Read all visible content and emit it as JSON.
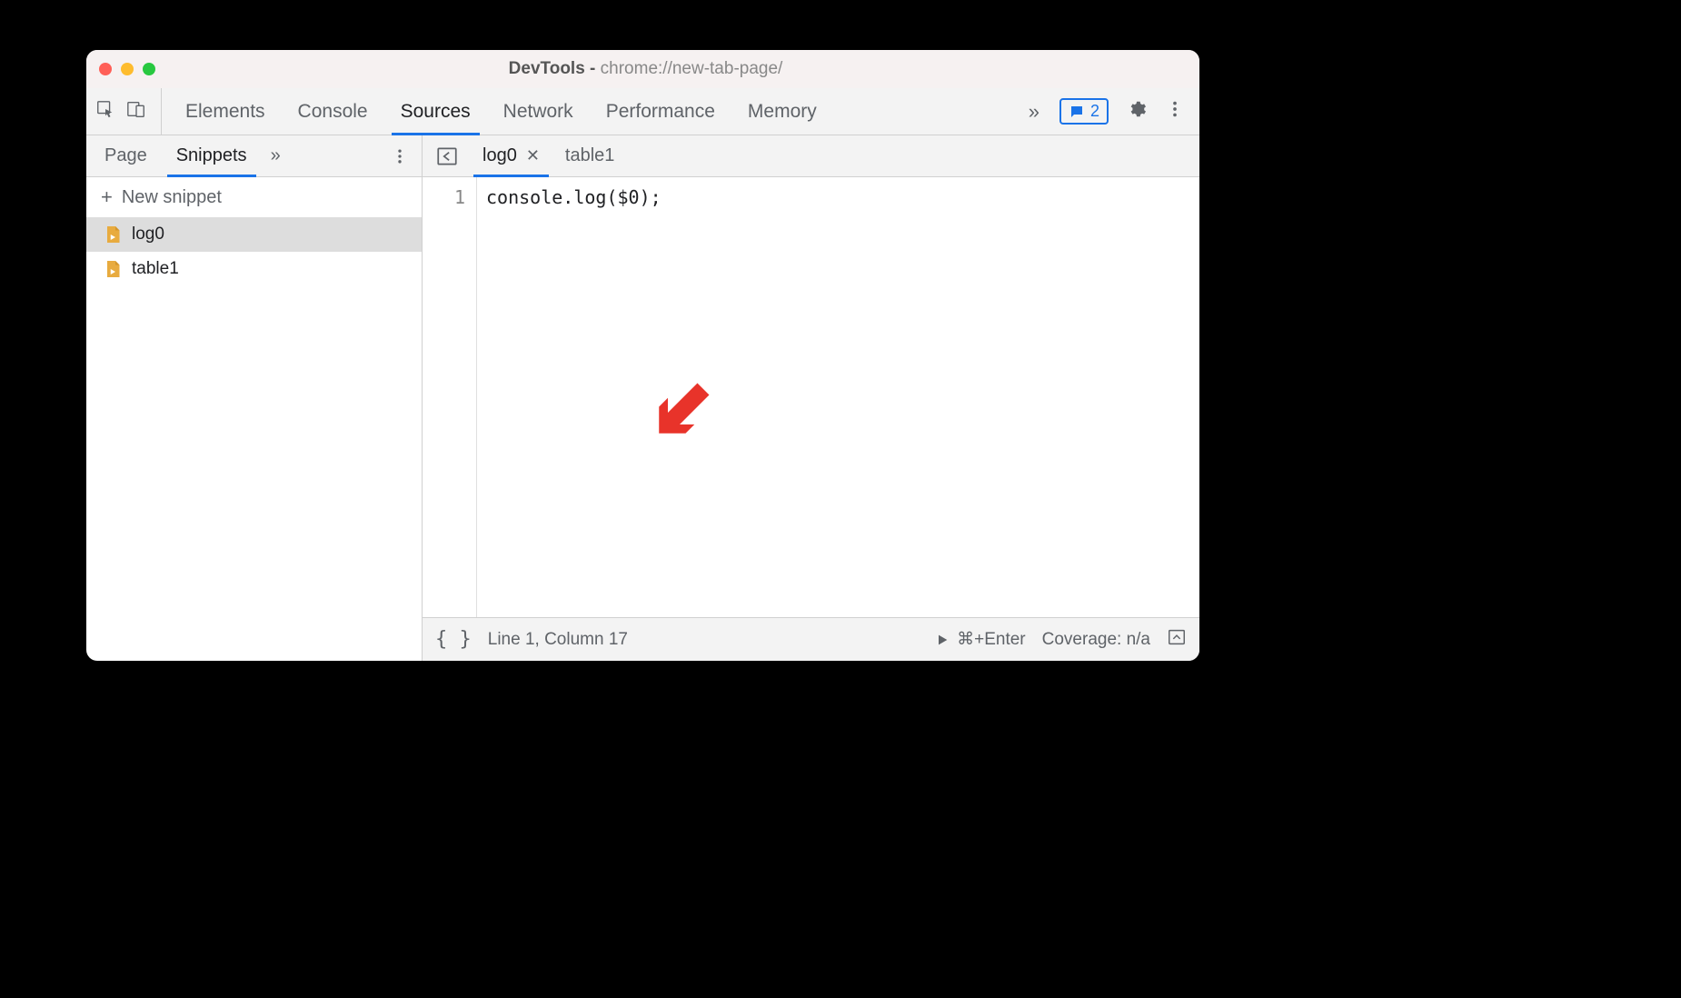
{
  "window_title_prefix": "DevTools - ",
  "window_title_url": "chrome://new-tab-page/",
  "main_tabs": [
    "Elements",
    "Console",
    "Sources",
    "Network",
    "Performance",
    "Memory"
  ],
  "main_tab_active": "Sources",
  "message_badge_count": "2",
  "side_tabs": [
    "Page",
    "Snippets"
  ],
  "side_tab_active": "Snippets",
  "new_snippet_label": "New snippet",
  "snippets": [
    "log0",
    "table1"
  ],
  "snippet_selected": "log0",
  "editor_tabs": [
    "log0",
    "table1"
  ],
  "editor_tab_active": "log0",
  "code_lines": [
    "console.log($0);"
  ],
  "status_cursor": "Line 1, Column 17",
  "status_run_shortcut": "⌘+Enter",
  "status_coverage": "Coverage: n/a"
}
